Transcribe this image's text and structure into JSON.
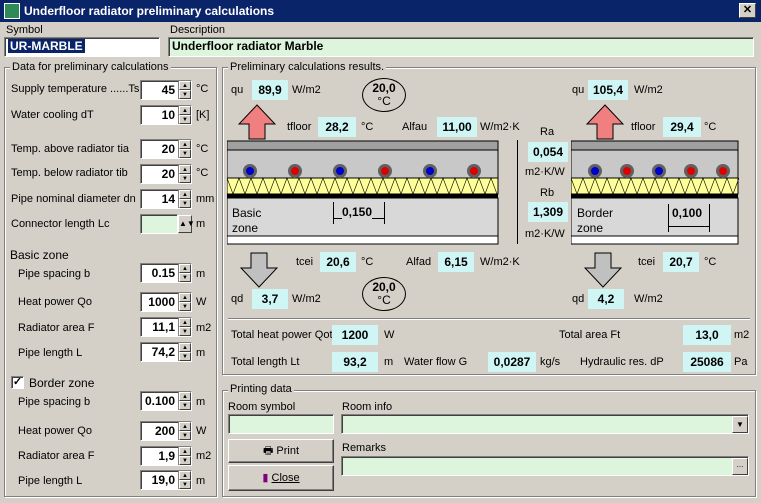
{
  "title": "Underfloor radiator preliminary calculations",
  "symbol": {
    "label": "Symbol",
    "value": "UR-MARBLE"
  },
  "description": {
    "label": "Description",
    "value": "Underfloor radiator Marble"
  },
  "prelim": {
    "title": "Data for preliminary calculations",
    "supply_temp": {
      "label": "Supply temperature ......Ts",
      "value": "45",
      "unit": "°C"
    },
    "water_cooling": {
      "label": "Water cooling dT",
      "value": "10",
      "unit": "[K]"
    },
    "temp_above": {
      "label": "Temp. above radiator tia",
      "value": "20",
      "unit": "°C"
    },
    "temp_below": {
      "label": "Temp. below radiator tib",
      "value": "20",
      "unit": "°C"
    },
    "pipe_dn": {
      "label": "Pipe nominal diameter dn",
      "value": "14",
      "unit": "mm"
    },
    "connector": {
      "label": "Connector length Lc",
      "value": "",
      "unit": "m"
    }
  },
  "basic": {
    "title": "Basic zone",
    "spacing": {
      "label": "Pipe spacing b",
      "value": "0.15",
      "unit": "m"
    },
    "heat": {
      "label": "Heat power Qo",
      "value": "1000",
      "unit": "W"
    },
    "area": {
      "label": "Radiator area F",
      "value": "11,1",
      "unit": "m2"
    },
    "length": {
      "label": "Pipe length L",
      "value": "74,2",
      "unit": "m"
    }
  },
  "border": {
    "title": "Border zone",
    "checked": "✓",
    "spacing": {
      "label": "Pipe spacing b",
      "value": "0.100",
      "unit": "m"
    },
    "heat": {
      "label": "Heat power Qo",
      "value": "200",
      "unit": "W"
    },
    "area": {
      "label": "Radiator area F",
      "value": "1,9",
      "unit": "m2"
    },
    "length": {
      "label": "Pipe length L",
      "value": "19,0",
      "unit": "m"
    }
  },
  "results": {
    "title": "Preliminary calculations results.",
    "qu_basic": {
      "label": "qu",
      "value": "89,9",
      "unit": "W/m2"
    },
    "qu_border": {
      "label": "qu",
      "value": "105,4",
      "unit": "W/m2"
    },
    "temp_top": {
      "value": "20,0",
      "unit": "°C"
    },
    "temp_bottom": {
      "value": "20,0",
      "unit": "°C"
    },
    "tfloor_basic": {
      "label": "tfloor",
      "value": "28,2",
      "unit": "°C"
    },
    "tfloor_border": {
      "label": "tfloor",
      "value": "29,4",
      "unit": "°C"
    },
    "alfau": {
      "label": "Alfau",
      "value": "11,00",
      "unit": "W/m2·K"
    },
    "ra": {
      "label": "Ra",
      "value": "0,054",
      "unit": "m2·K/W"
    },
    "rb": {
      "label": "Rb",
      "value": "1,309",
      "unit": "m2·K/W"
    },
    "basic_zone_name_1": "Basic",
    "basic_zone_name_2": "zone",
    "border_zone_name_1": "Border",
    "border_zone_name_2": "zone",
    "spacing_basic": "0,150",
    "spacing_border": "0,100",
    "tcei_basic": {
      "label": "tcei",
      "value": "20,6",
      "unit": "°C"
    },
    "tcei_border": {
      "label": "tcei",
      "value": "20,7",
      "unit": "°C"
    },
    "alfad": {
      "label": "Alfad",
      "value": "6,15",
      "unit": "W/m2·K"
    },
    "qd_basic": {
      "label": "qd",
      "value": "3,7",
      "unit": "W/m2"
    },
    "qd_border": {
      "label": "qd",
      "value": "4,2",
      "unit": "W/m2"
    },
    "total_heat": {
      "label": "Total heat power Qot",
      "value": "1200",
      "unit": "W"
    },
    "total_area": {
      "label": "Total area Ft",
      "value": "13,0",
      "unit": "m2"
    },
    "total_length": {
      "label": "Total length Lt",
      "value": "93,2",
      "unit": "m"
    },
    "water_flow": {
      "label": "Water flow G",
      "value": "0,0287",
      "unit": "kg/s"
    },
    "hydraulic": {
      "label": "Hydraulic res. dP",
      "value": "25086",
      "unit": "Pa"
    }
  },
  "printing": {
    "title": "Printing data",
    "room_symbol": {
      "label": "Room symbol",
      "value": ""
    },
    "room_info": {
      "label": "Room info",
      "value": ""
    },
    "remarks": {
      "label": "Remarks",
      "value": ""
    },
    "print_label": "Print",
    "close_label": "Close",
    "browse_label": "..."
  },
  "colors": {
    "title_bar": "#0a246a",
    "field_green": "#dcf5dc",
    "field_cyan": "#cff5f5",
    "arrow_up": "#f08080",
    "arrow_down": "#c0c0c0",
    "insulation": "#ffff99",
    "pipe_hot": "#dd0000",
    "pipe_cold": "#0000cc"
  }
}
